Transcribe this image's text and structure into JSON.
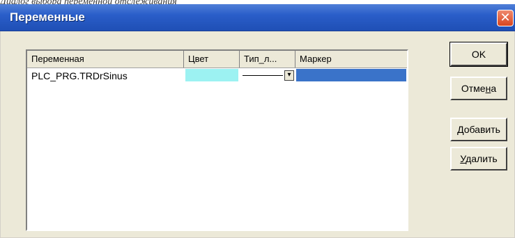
{
  "caption": "Диалог выбора переменной отслеживания",
  "dialog": {
    "title": "Переменные",
    "close_symbol": "✕"
  },
  "table": {
    "columns": [
      "Переменная",
      "Цвет",
      "Тип_л...",
      "Маркер"
    ],
    "rows": [
      {
        "variable": "PLC_PRG.TRDrSinus",
        "color": "#9cf2f2",
        "line_type": "solid",
        "marker_color": "#3a73c9"
      }
    ],
    "dropdown_arrow": "▾"
  },
  "buttons": {
    "ok": "OK",
    "cancel": {
      "pre": "Отме",
      "ul": "н",
      "post": "а"
    },
    "add": {
      "pre": "",
      "ul": "Д",
      "post": "обавить"
    },
    "delete": {
      "pre": "",
      "ul": "У",
      "post": "далить"
    }
  }
}
